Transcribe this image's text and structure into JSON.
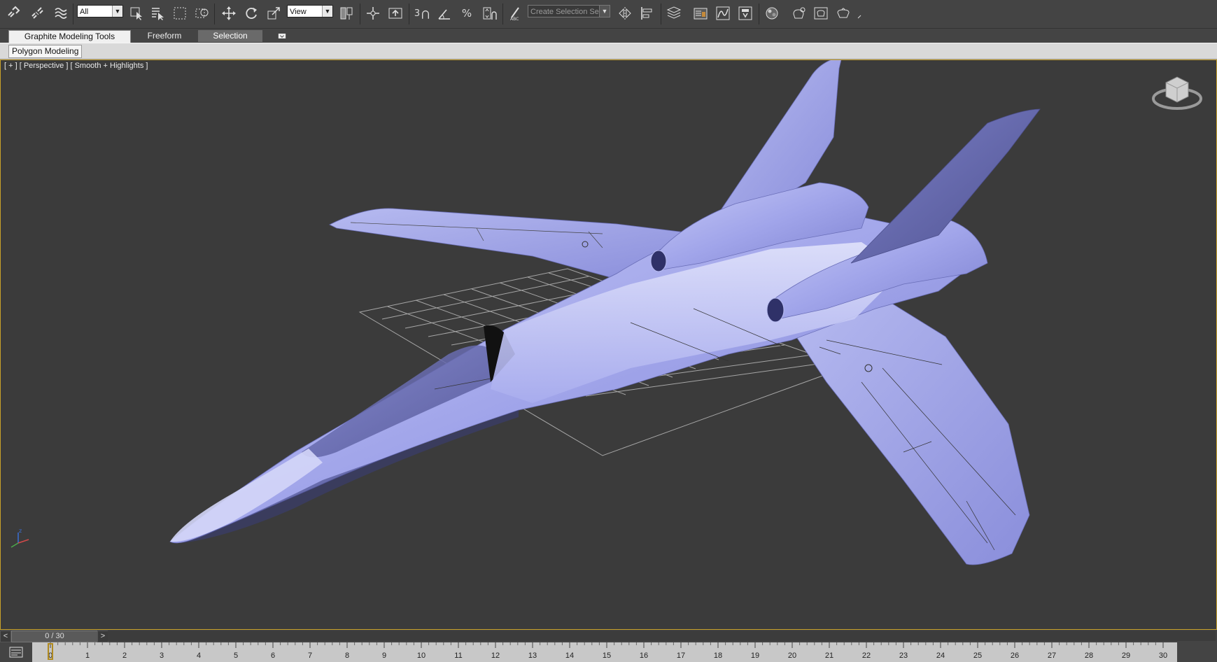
{
  "toolbar": {
    "selection_filter": "All",
    "reference_coord": "View",
    "snap_label": "3",
    "named_selection_placeholder": "Create Selection Se",
    "icons": [
      "link-icon",
      "unlink-icon",
      "bind-space-warp-icon",
      "select-object-icon",
      "select-by-name-icon",
      "rect-selection-icon",
      "window-crossing-icon",
      "move-icon",
      "rotate-icon",
      "scale-icon",
      "use-pivot-icon",
      "select-manipulate-icon",
      "keyboard-shortcut-icon",
      "snaps-toggle-icon",
      "angle-snap-icon",
      "percent-snap-icon",
      "spinner-snap-icon",
      "edit-named-selection-icon",
      "mirror-icon",
      "align-icon",
      "layer-explorer-icon",
      "toggle-scene-explorer-icon",
      "curve-editor-icon",
      "schematic-view-icon",
      "material-editor-icon",
      "render-setup-icon",
      "rendered-frame-window-icon",
      "render-production-icon",
      "render-iterative-icon"
    ]
  },
  "ribbon": {
    "tabs": [
      "Graphite Modeling Tools",
      "Freeform",
      "Selection"
    ],
    "panel_label": "Polygon Modeling"
  },
  "viewport": {
    "label": "[ + ] [ Perspective ] [ Smooth + Highlights ]",
    "model_color": "#9a9ee6",
    "border_color": "#c8a12a"
  },
  "timeslider": {
    "frame_display": "0 / 30",
    "prev": "<",
    "next": ">"
  },
  "trackbar": {
    "frame_ticks": [
      "0",
      "1",
      "2",
      "3",
      "4",
      "5",
      "6",
      "7",
      "8",
      "9",
      "10",
      "11",
      "12",
      "13",
      "14",
      "15",
      "16",
      "17",
      "18",
      "19",
      "20",
      "21",
      "22",
      "23",
      "24",
      "25",
      "26",
      "27",
      "28",
      "29",
      "30"
    ]
  }
}
